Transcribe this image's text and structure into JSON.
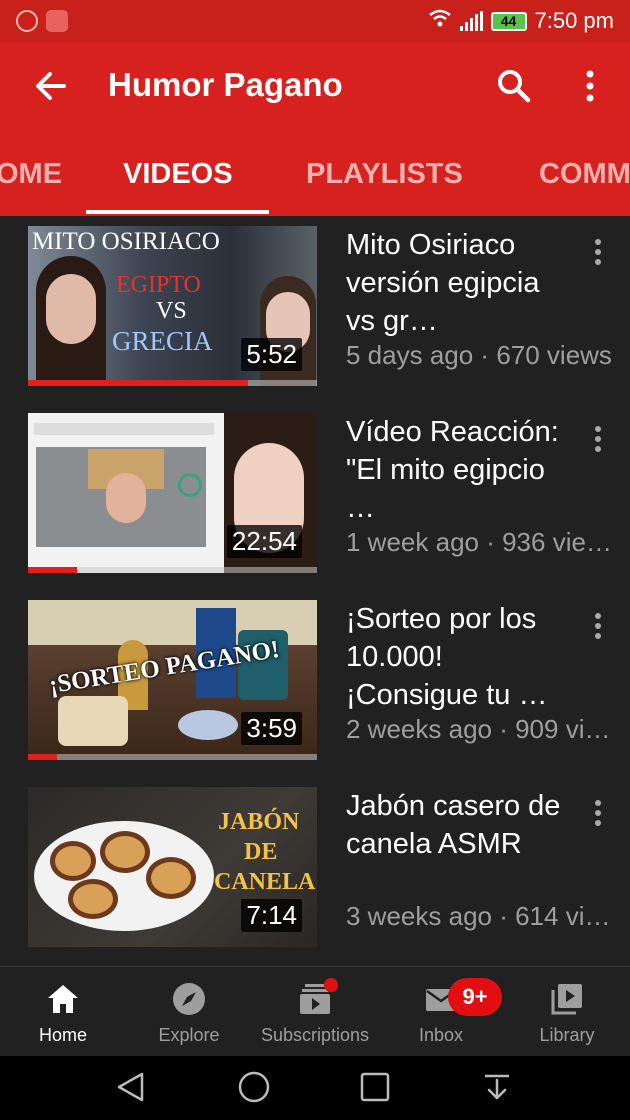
{
  "status_bar": {
    "time": "7:50 pm",
    "battery": "44"
  },
  "app_bar": {
    "title": "Humor Pagano"
  },
  "tabs": [
    {
      "label": "OME"
    },
    {
      "label": "VIDEOS"
    },
    {
      "label": "PLAYLISTS"
    },
    {
      "label": "COMM"
    }
  ],
  "active_tab": "VIDEOS",
  "videos": [
    {
      "title": "Mito Osiriaco versión egipcia vs gr…",
      "meta": "5 days ago · 670 views",
      "duration": "5:52",
      "watched_progress": 0.76,
      "thumb_text": [
        "MITO OSIRIACO",
        "EGIPTO",
        "VS",
        "GRECIA"
      ]
    },
    {
      "title": "Vídeo Reacción: \"El mito egipcio …",
      "meta": "1 week ago · 936 vie…",
      "duration": "22:54",
      "watched_progress": 0.17,
      "thumb_text": []
    },
    {
      "title": "¡Sorteo por los 10.000! ¡Consigue tu …",
      "meta": "2 weeks ago · 909 vi…",
      "duration": "3:59",
      "watched_progress": 0.1,
      "thumb_text": [
        "¡SORTEO PAGANO!"
      ]
    },
    {
      "title": "Jabón casero de canela ASMR",
      "meta": "3 weeks ago · 614 vi…",
      "duration": "7:14",
      "watched_progress": 0,
      "thumb_text": [
        "JABÓN",
        "DE",
        "CANELA"
      ]
    }
  ],
  "bottom_nav": [
    {
      "label": "Home",
      "icon": "home-icon",
      "active": true
    },
    {
      "label": "Explore",
      "icon": "compass-icon",
      "active": false
    },
    {
      "label": "Subscriptions",
      "icon": "subscriptions-icon",
      "active": false
    },
    {
      "label": "Inbox",
      "icon": "inbox-icon",
      "active": false
    },
    {
      "label": "Library",
      "icon": "library-icon",
      "active": false
    }
  ],
  "inbox_badge": "9+",
  "colors": {
    "brand_red": "#d7211f",
    "status_red": "#c8201a",
    "background": "#212121",
    "progress_red": "#e0201c",
    "muted_text": "#9e9e9e",
    "badge_red": "#e10f12"
  }
}
